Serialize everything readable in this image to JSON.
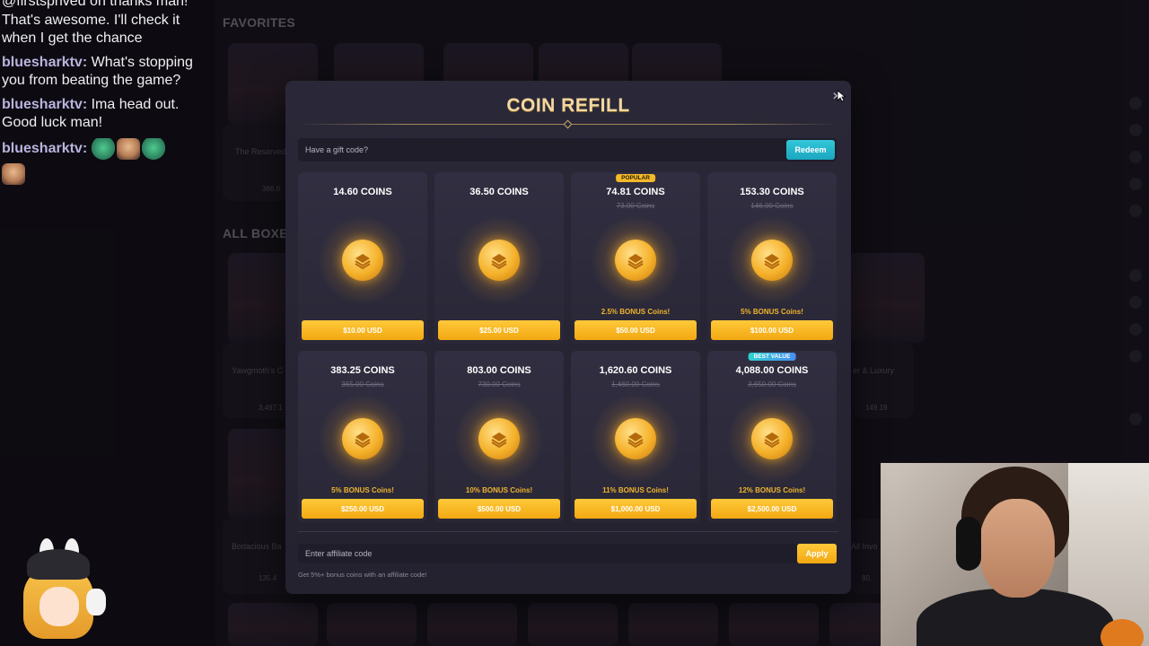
{
  "background": {
    "favorites_heading": "FAVORITES",
    "all_boxes_heading": "ALL BOXES",
    "cards": [
      {
        "label": "The Reserved",
        "price": "366.6"
      },
      {
        "label": "Yawgmoth's C",
        "price": "3,497.1"
      },
      {
        "label": "Bodacious Ba",
        "price": "135.4"
      },
      {
        "label": "er & Luxury",
        "price": "149.19"
      },
      {
        "label": "All Invo",
        "price": "80."
      }
    ]
  },
  "chat": {
    "messages": [
      {
        "user": "",
        "text": "@firstsprived on thanks man! That's awesome. I'll check it when I get the chance"
      },
      {
        "user": "bluesharktv",
        "text": "What's stopping you from beating the game?"
      },
      {
        "user": "bluesharktv",
        "text": "Ima head out. Good luck man!"
      },
      {
        "user": "bluesharktv",
        "text": ""
      }
    ]
  },
  "modal": {
    "title": "COIN REFILL",
    "close_icon": "×",
    "gift": {
      "placeholder": "Have a gift code?",
      "button": "Redeem"
    },
    "packs": [
      {
        "coins": "14.60 COINS",
        "old": "",
        "badge": "",
        "bonus": "",
        "price": "$10.00 USD"
      },
      {
        "coins": "36.50 COINS",
        "old": "",
        "badge": "",
        "bonus": "",
        "price": "$25.00 USD"
      },
      {
        "coins": "74.81 COINS",
        "old": "73.00 Coins",
        "badge": "POPULAR",
        "bonus": "2.5% BONUS Coins!",
        "price": "$50.00 USD"
      },
      {
        "coins": "153.30 COINS",
        "old": "146.00 Coins",
        "badge": "",
        "bonus": "5% BONUS Coins!",
        "price": "$100.00 USD"
      },
      {
        "coins": "383.25 COINS",
        "old": "365.00 Coins",
        "badge": "",
        "bonus": "5% BONUS Coins!",
        "price": "$250.00 USD"
      },
      {
        "coins": "803.00 COINS",
        "old": "730.00 Coins",
        "badge": "",
        "bonus": "10% BONUS Coins!",
        "price": "$500.00 USD"
      },
      {
        "coins": "1,620.60 COINS",
        "old": "1,460.00 Coins",
        "badge": "",
        "bonus": "11% BONUS Coins!",
        "price": "$1,000.00 USD"
      },
      {
        "coins": "4,088.00 COINS",
        "old": "3,650.00 Coins",
        "badge": "BEST VALUE",
        "bonus": "12% BONUS Coins!",
        "price": "$2,500.00 USD"
      }
    ],
    "affiliate": {
      "placeholder": "Enter affiliate code",
      "button": "Apply",
      "hint": "Get 5%+ bonus coins with an affiliate code!"
    }
  },
  "colors": {
    "accent_gold": "#f2a812",
    "accent_cyan": "#1aa6c0",
    "title_gold": "#f2d7a1"
  }
}
